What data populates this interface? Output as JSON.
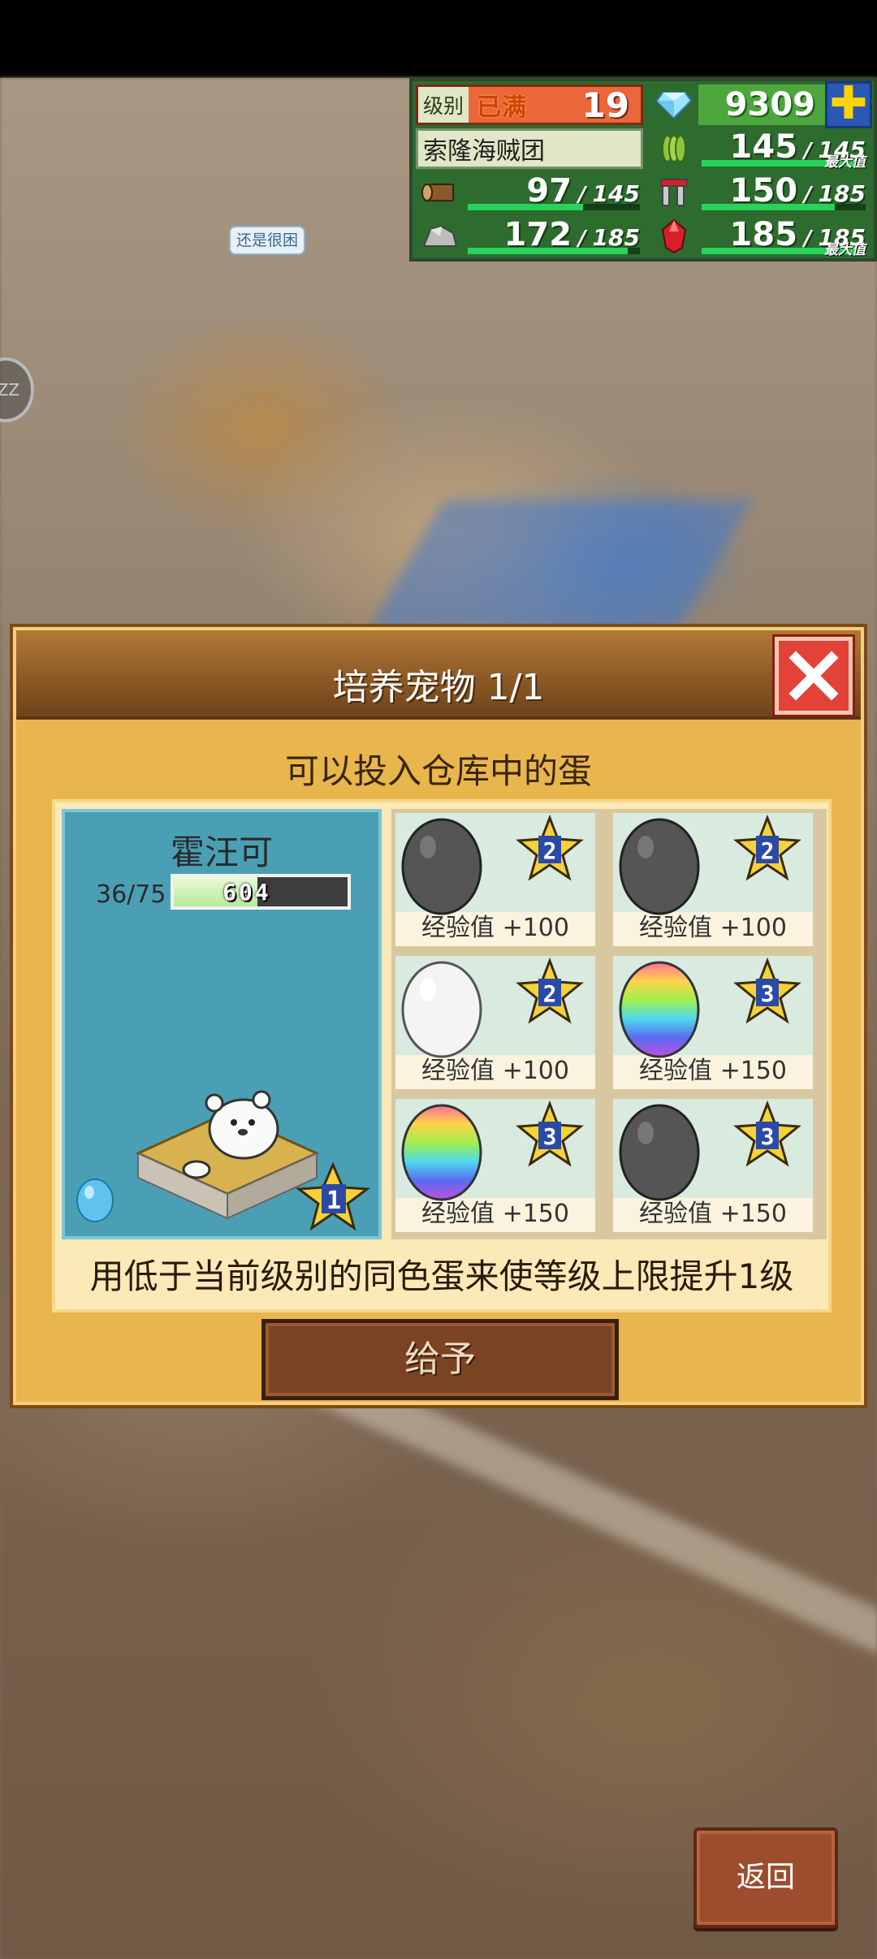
{
  "hud": {
    "level_label": "级别",
    "level_badge": "已满",
    "level_value": "19",
    "gems": "9309",
    "plus": "✚",
    "team_name": "索隆海贼团",
    "max_label": "最大值",
    "resources": [
      {
        "name": "food",
        "icon": "grain-icon",
        "value": "145",
        "max": "145",
        "fill": 1.0,
        "at_max": true,
        "color": "#8cc63f"
      },
      {
        "name": "wood",
        "icon": "log-icon",
        "value": "97",
        "max": "145",
        "fill": 0.67,
        "at_max": false,
        "color": "#8b5a2b"
      },
      {
        "name": "tools",
        "icon": "tools-icon",
        "value": "150",
        "max": "185",
        "fill": 0.81,
        "at_max": false,
        "color": "#c0c0c0"
      },
      {
        "name": "stone",
        "icon": "stone-icon",
        "value": "172",
        "max": "185",
        "fill": 0.93,
        "at_max": false,
        "color": "#b0b0b0"
      },
      {
        "name": "ruby",
        "icon": "ruby-icon",
        "value": "185",
        "max": "185",
        "fill": 1.0,
        "at_max": true,
        "color": "#d8202a"
      }
    ]
  },
  "world": {
    "speech_bubble": "还是很困",
    "left_bubble": "ZZ"
  },
  "dialog": {
    "title": "培养宠物 1/1",
    "subtitle": "可以投入仓库中的蛋",
    "pet": {
      "name": "霍汪可",
      "exp_text": "36/75",
      "exp_fraction": 0.48,
      "exp_bar_label": "604",
      "level_star": "1"
    },
    "eggs": [
      {
        "color": "gray",
        "stars": "2",
        "exp": "经验值 +100"
      },
      {
        "color": "gray",
        "stars": "2",
        "exp": "经验值 +100"
      },
      {
        "color": "white",
        "stars": "2",
        "exp": "经验值 +100"
      },
      {
        "color": "rainbow",
        "stars": "3",
        "exp": "经验值 +150"
      },
      {
        "color": "rainbow",
        "stars": "3",
        "exp": "经验值 +150"
      },
      {
        "color": "gray",
        "stars": "3",
        "exp": "经验值 +150"
      }
    ],
    "note": "用低于当前级别的同色蛋来使等级上限提升1级",
    "give_button": "给予"
  },
  "back_button": "返回",
  "colors": {
    "dialog_bg": "#e8b64d",
    "header": "#8d5a26",
    "pet_panel": "#4b9fb4",
    "close_button": "#e34238"
  }
}
